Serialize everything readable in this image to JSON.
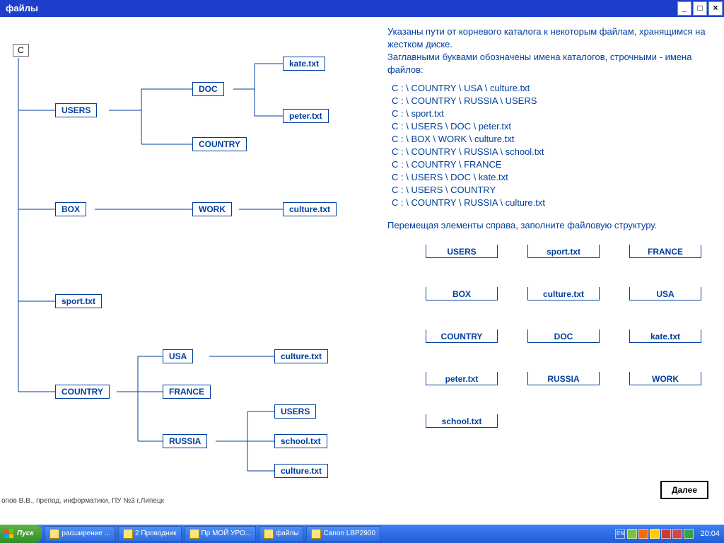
{
  "window": {
    "title": "файлы"
  },
  "tree": {
    "root": "C",
    "nodes": {
      "users": "USERS",
      "box": "BOX",
      "sport": "sport.txt",
      "country": "COUNTRY",
      "doc": "DOC",
      "countrySub": "COUNTRY",
      "work": "WORK",
      "kate": "kate.txt",
      "peter": "peter.txt",
      "culturebox": "culture.txt",
      "usa": "USA",
      "france": "FRANCE",
      "russia": "RUSSIA",
      "cultureusa": "culture.txt",
      "usersru": "USERS",
      "schoolru": "school.txt",
      "cultureru": "culture.txt"
    }
  },
  "text": {
    "desc1": "Указаны пути от корневого каталога к некоторым файлам, хранящимся на жестком диске.",
    "desc2": "Заглавными буквами обозначены имена каталогов, строчными - имена файлов:",
    "instr": "Перемещая элементы справа, заполните файловую структуру.",
    "next": "Далее"
  },
  "paths": [
    "C : \\ COUNTRY \\ USA \\ culture.txt",
    "C : \\ COUNTRY \\ RUSSIA \\ USERS",
    "C : \\ sport.txt",
    "C : \\ USERS \\ DOC \\ peter.txt",
    "C : \\ BOX \\ WORK \\ culture.txt",
    "C : \\ COUNTRY \\ RUSSIA \\ school.txt",
    "C : \\ COUNTRY \\ FRANCE",
    "C : \\ USERS \\ DOC \\ kate.txt",
    "C : \\ USERS \\ COUNTRY",
    "C : \\ COUNTRY \\ RUSSIA \\ culture.txt"
  ],
  "pool": [
    {
      "l": "USERS"
    },
    {
      "l": "sport.txt"
    },
    {
      "l": "FRANCE"
    },
    {
      "l": "BOX"
    },
    {
      "l": "culture.txt"
    },
    {
      "l": "USA"
    },
    {
      "l": "COUNTRY"
    },
    {
      "l": "DOC"
    },
    {
      "l": "kate.txt"
    },
    {
      "l": "peter.txt"
    },
    {
      "l": "RUSSIA"
    },
    {
      "l": "WORK"
    },
    {
      "l": "school.txt"
    }
  ],
  "credit": "опов В.В., препод. информатики, ПУ №3 г.Липецк",
  "taskbar": {
    "start": "Пуск",
    "buttons": [
      "расширение ...",
      "2 Проводник",
      "Пр МОЙ УРО...",
      "файлы",
      "Canon LBP2900"
    ],
    "lang": "EN",
    "clock": "20:04"
  },
  "tray_colors": [
    "#7CC142",
    "#FF6A00",
    "#FFCC00",
    "#C63C3C",
    "#D64545",
    "#3BA14A"
  ]
}
